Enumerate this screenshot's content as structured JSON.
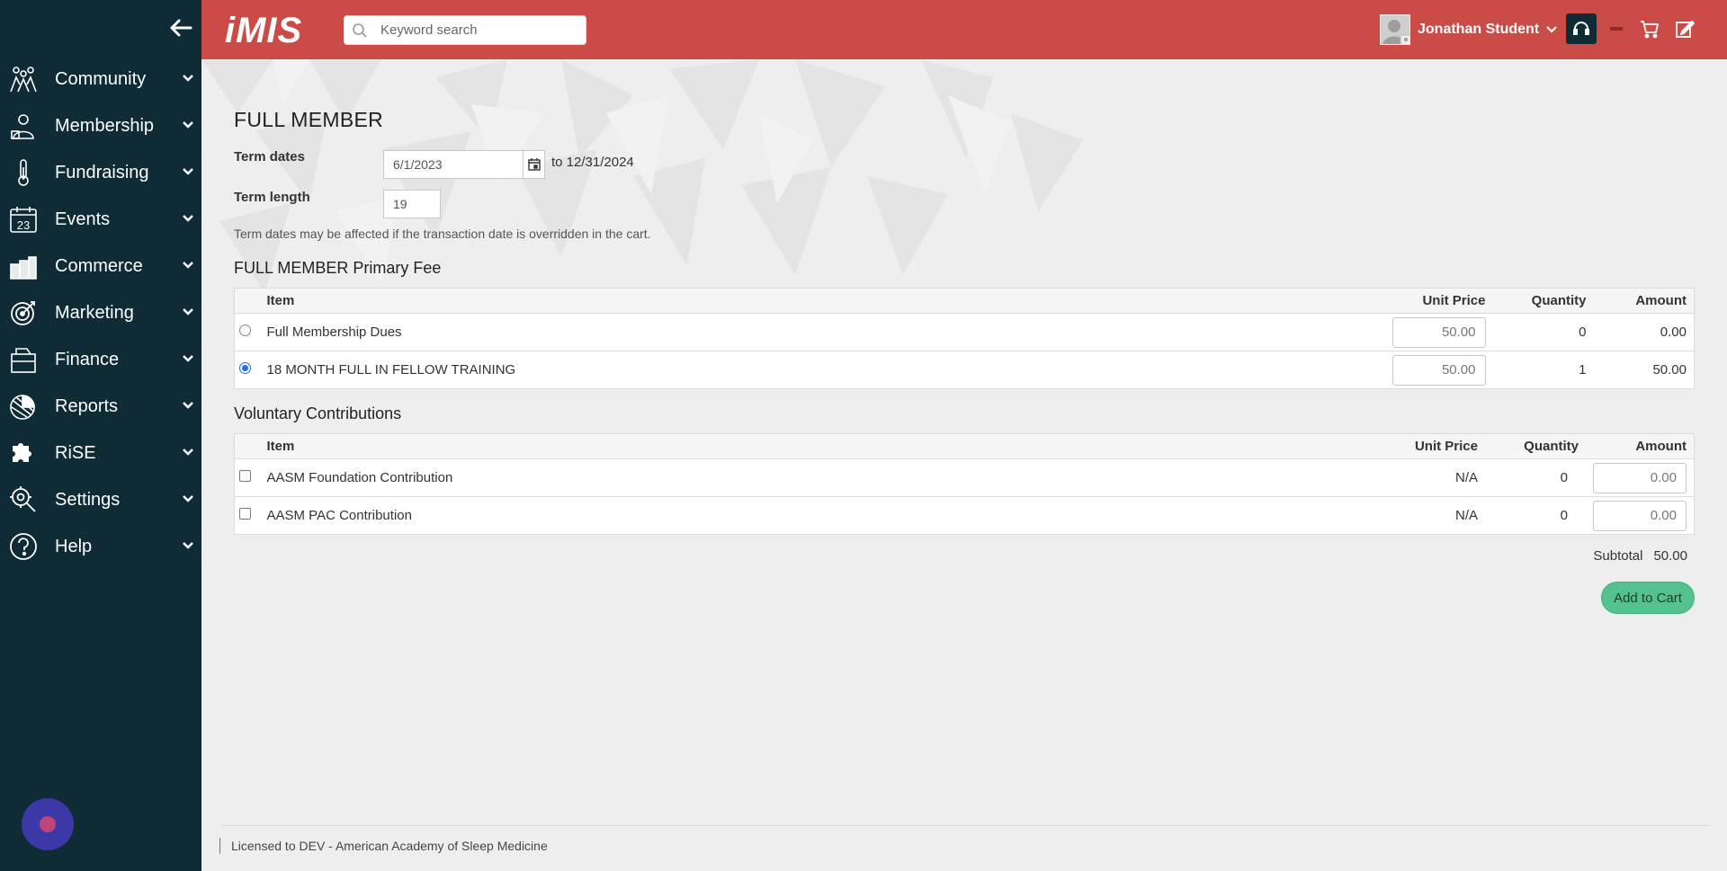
{
  "header": {
    "logo": "iMIS",
    "search_placeholder": "Keyword search",
    "user_name": "Jonathan Student",
    "accent_color": "#cb4b47"
  },
  "sidebar": {
    "background_color": "#0f2b35",
    "items": [
      {
        "label": "Community",
        "icon": "community-icon"
      },
      {
        "label": "Membership",
        "icon": "membership-icon"
      },
      {
        "label": "Fundraising",
        "icon": "fundraising-icon"
      },
      {
        "label": "Events",
        "icon": "calendar-icon"
      },
      {
        "label": "Commerce",
        "icon": "commerce-icon"
      },
      {
        "label": "Marketing",
        "icon": "target-icon"
      },
      {
        "label": "Finance",
        "icon": "finance-icon"
      },
      {
        "label": "Reports",
        "icon": "reports-icon"
      },
      {
        "label": "RiSE",
        "icon": "puzzle-icon"
      },
      {
        "label": "Settings",
        "icon": "settings-icon"
      },
      {
        "label": "Help",
        "icon": "help-icon"
      }
    ]
  },
  "page": {
    "title": "FULL MEMBER",
    "term_dates_label": "Term dates",
    "term_start": "6/1/2023",
    "term_to": "to 12/31/2024",
    "term_length_label": "Term length",
    "term_length": "19",
    "note": "Term dates may be affected if the transaction date is overridden in the cart."
  },
  "primary_fee": {
    "title": "FULL MEMBER Primary Fee",
    "headers": {
      "item": "Item",
      "unit_price": "Unit Price",
      "quantity": "Quantity",
      "amount": "Amount"
    },
    "rows": [
      {
        "item": "Full Membership Dues",
        "unit_price": "50.00",
        "quantity": "0",
        "amount": "0.00",
        "selected": false
      },
      {
        "item": "18 MONTH FULL IN FELLOW TRAINING",
        "unit_price": "50.00",
        "quantity": "1",
        "amount": "50.00",
        "selected": true
      }
    ]
  },
  "voluntary": {
    "title": "Voluntary Contributions",
    "headers": {
      "item": "Item",
      "unit_price": "Unit Price",
      "quantity": "Quantity",
      "amount": "Amount"
    },
    "rows": [
      {
        "item": "AASM Foundation Contribution",
        "unit_price": "N/A",
        "quantity": "0",
        "amount": "0.00",
        "checked": false
      },
      {
        "item": "AASM PAC Contribution",
        "unit_price": "N/A",
        "quantity": "0",
        "amount": "0.00",
        "checked": false
      }
    ]
  },
  "summary": {
    "subtotal_label": "Subtotal",
    "subtotal_value": "50.00",
    "add_to_cart": "Add to Cart",
    "button_color": "#54c28f"
  },
  "footer": {
    "license": "Licensed to DEV - American Academy of Sleep Medicine"
  }
}
